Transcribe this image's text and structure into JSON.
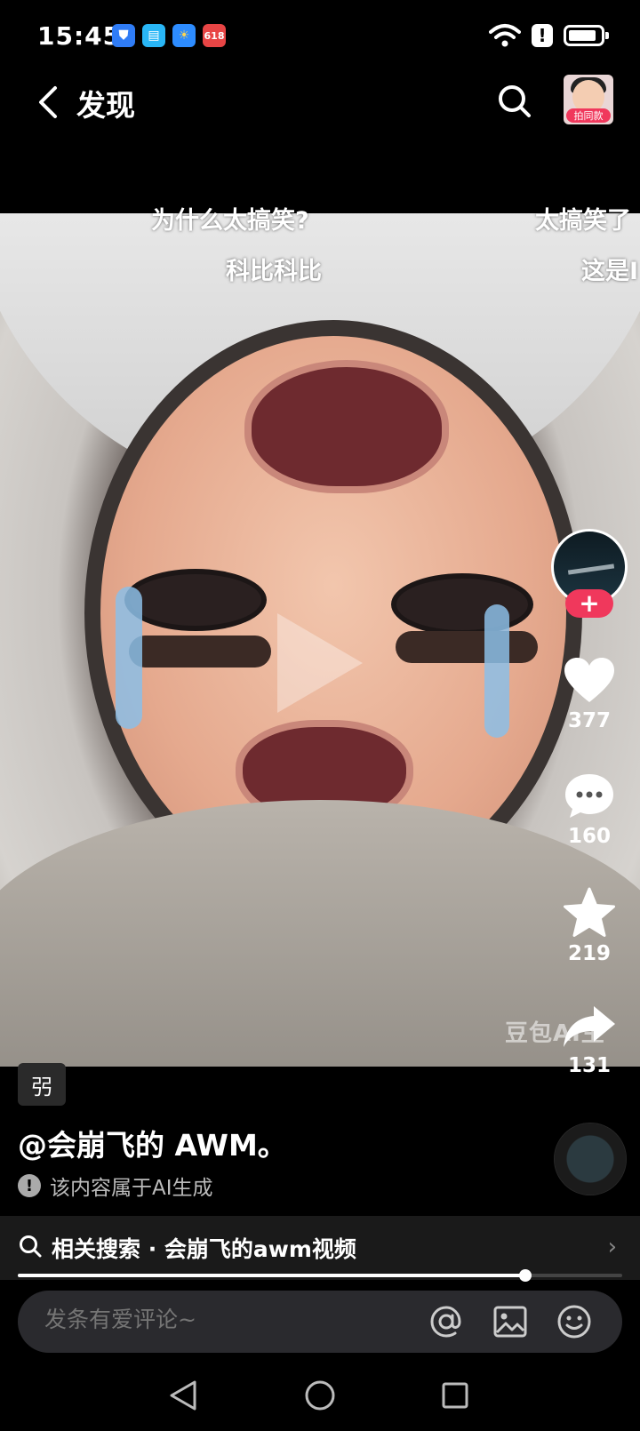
{
  "status_bar": {
    "time": "15:45",
    "app_icons": [
      {
        "name": "shield-app-icon",
        "color": "#2f7cf6",
        "glyph": "⛊"
      },
      {
        "name": "book-app-icon",
        "color": "#29b6f6",
        "glyph": "▤"
      },
      {
        "name": "weather-app-icon",
        "color": "#2d8cff",
        "glyph": "☀"
      },
      {
        "name": "shopping-app-icon",
        "color": "#e84545",
        "glyph": "618"
      }
    ],
    "alert_glyph": "!"
  },
  "header": {
    "title": "发现",
    "profile_badge": "拍同款"
  },
  "danmaku": [
    {
      "text": "为什么太搞笑?"
    },
    {
      "text": "太搞笑了"
    },
    {
      "text": "科比科比"
    },
    {
      "text": "这是I"
    }
  ],
  "video": {
    "watermark": "豆包AI生"
  },
  "right_rail": {
    "follow_label": "+",
    "likes": "377",
    "comments": "160",
    "favorites": "219",
    "shares": "131"
  },
  "post": {
    "tag": "弜",
    "author": "@会崩飞的 AWM。",
    "ai_notice": "该内容属于AI生成",
    "ai_notice_glyph": "!"
  },
  "related": {
    "text": "相关搜索 · 会崩飞的awm视频",
    "chevron": "›"
  },
  "progress": {
    "played_fraction": 0.84
  },
  "comment_bar": {
    "placeholder": "发条有爱评论~"
  },
  "colors": {
    "accent": "#f0385c",
    "background": "#000000"
  }
}
